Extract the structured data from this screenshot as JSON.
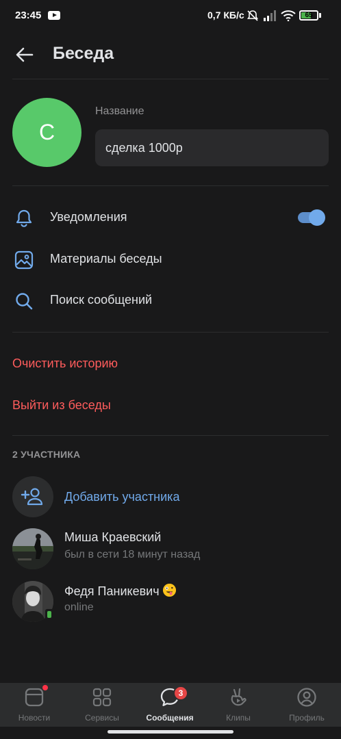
{
  "status_bar": {
    "time": "23:45",
    "speed": "0,7 КБ/с",
    "battery": "65",
    "battery_level": 0.65
  },
  "header": {
    "title": "Беседа",
    "back_icon": "arrow-left-icon"
  },
  "chat": {
    "avatar_letter": "С",
    "avatar_color": "#58c96a",
    "name_label": "Название",
    "name_value": "сделка 1000р"
  },
  "menu": {
    "notifications": {
      "label": "Уведомления",
      "icon": "bell-icon",
      "enabled": true
    },
    "media": {
      "label": "Материалы беседы",
      "icon": "image-icon"
    },
    "search": {
      "label": "Поиск сообщений",
      "icon": "search-icon"
    }
  },
  "actions": {
    "clear_history": "Очистить историю",
    "leave_chat": "Выйти из беседы"
  },
  "members": {
    "section_title": "2 УЧАСТНИКА",
    "add_label": "Добавить участника",
    "list": [
      {
        "name": "Миша Краевский",
        "status": "был в сети 18 минут назад"
      },
      {
        "name": "Федя Паникевич",
        "status": "online",
        "emoji": "zany-face-emoji"
      }
    ]
  },
  "tabbar": {
    "tabs": [
      {
        "label": "Новости",
        "icon": "news-icon"
      },
      {
        "label": "Сервисы",
        "icon": "services-icon"
      },
      {
        "label": "Сообщения",
        "icon": "messages-icon",
        "badge": "3",
        "active": true
      },
      {
        "label": "Клипы",
        "icon": "clips-icon"
      },
      {
        "label": "Профиль",
        "icon": "profile-icon"
      }
    ]
  },
  "colors": {
    "background": "#19191a",
    "accent": "#71aaeb",
    "danger": "#ff5c5c",
    "badge": "#e64646"
  }
}
